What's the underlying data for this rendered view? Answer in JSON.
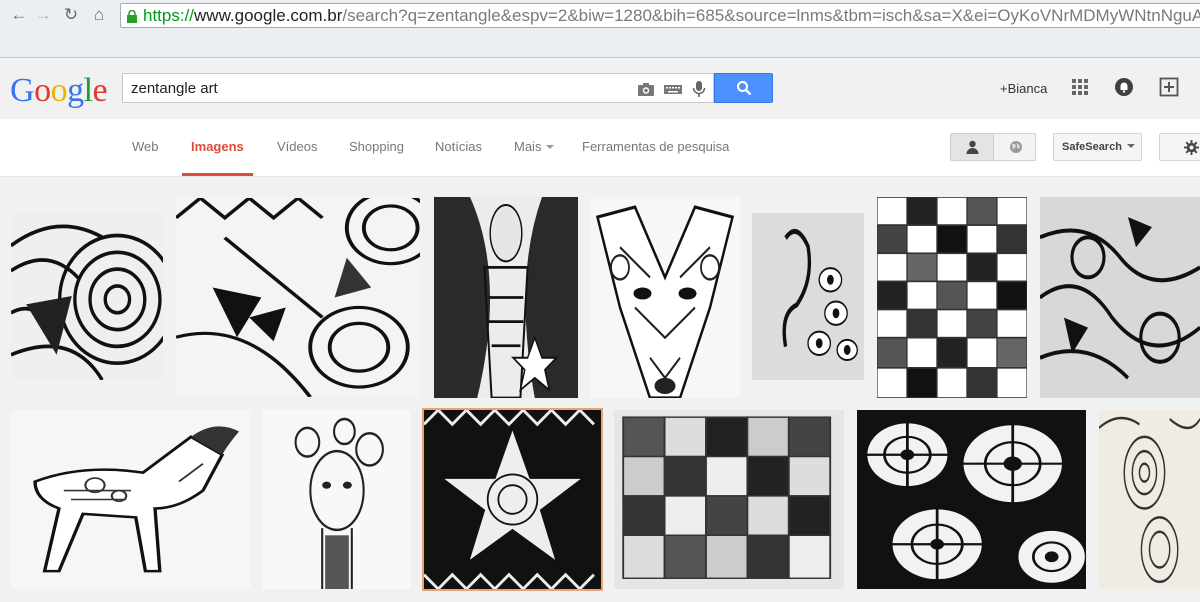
{
  "browser": {
    "url_scheme": "https://",
    "url_host": "www.google.com.br",
    "url_rest": "/search?q=zentangle&espv=2&biw=1280&bih=685&source=lnms&tbm=isch&sa=X&ei=OyKoVNrMDMyWNtnNguAI&ved"
  },
  "header": {
    "logo_text": "Google",
    "search_value": "zentangle art",
    "user_name": "+Bianca"
  },
  "tabs": [
    {
      "label": "Web"
    },
    {
      "label": "Imagens"
    },
    {
      "label": "Vídeos"
    },
    {
      "label": "Shopping"
    },
    {
      "label": "Notícias"
    },
    {
      "label": "Mais"
    },
    {
      "label": "Ferramentas de pesquisa"
    }
  ],
  "controls": {
    "safesearch_label": "SafeSearch"
  },
  "colors": {
    "accent_red": "#dd4b39",
    "search_blue": "#4d90fe"
  },
  "icons": {
    "back": "back-arrow-icon",
    "forward": "forward-arrow-icon",
    "reload": "reload-icon",
    "home": "home-icon",
    "lock": "lock-icon",
    "camera": "camera-icon",
    "keyboard": "keyboard-icon",
    "mic": "microphone-icon",
    "search": "search-icon",
    "apps": "apps-grid-icon",
    "notifications": "notifications-icon",
    "share": "share-plus-icon",
    "settings": "gear-icon"
  }
}
